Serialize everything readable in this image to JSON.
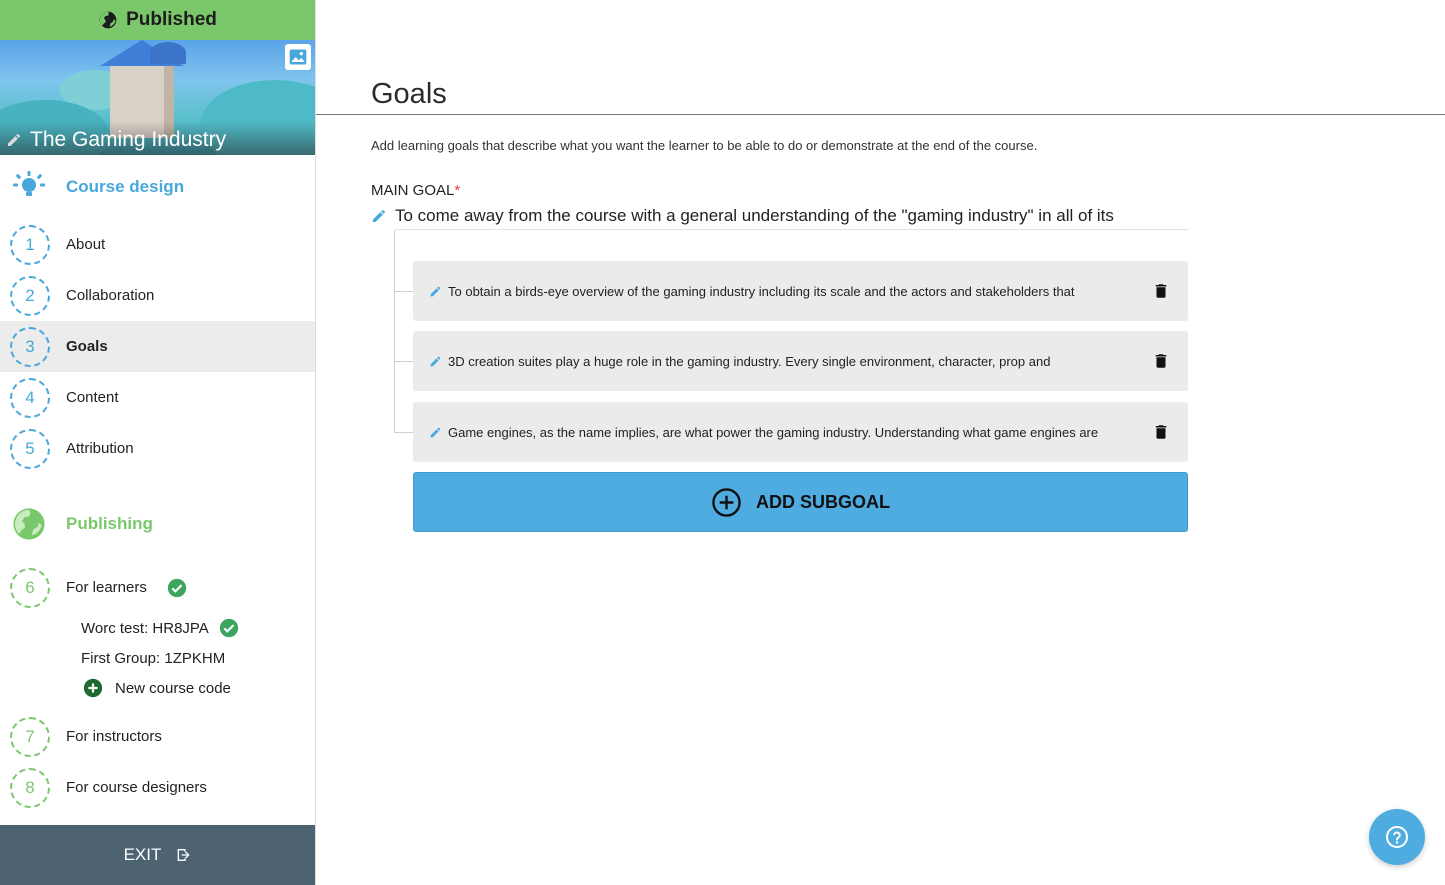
{
  "sidebar": {
    "status": "Published",
    "course_title": "The Gaming Industry",
    "design_heading": "Course design",
    "design_items": [
      {
        "num": "1",
        "label": "About"
      },
      {
        "num": "2",
        "label": "Collaboration"
      },
      {
        "num": "3",
        "label": "Goals"
      },
      {
        "num": "4",
        "label": "Content"
      },
      {
        "num": "5",
        "label": "Attribution"
      }
    ],
    "publishing_heading": "Publishing",
    "publishing_items": [
      {
        "num": "6",
        "label": "For learners"
      },
      {
        "num": "7",
        "label": "For instructors"
      },
      {
        "num": "8",
        "label": "For course designers"
      }
    ],
    "course_codes": [
      {
        "label": "Worc test: HR8JPA"
      },
      {
        "label": "First Group: 1ZPKHM"
      }
    ],
    "new_code_label": "New course code",
    "exit_label": "EXIT"
  },
  "main": {
    "title": "Goals",
    "description": "Add learning goals that describe what you want the learner to be able to do or demonstrate at the end of the course.",
    "main_goal_label": "MAIN GOAL",
    "required_mark": "*",
    "main_goal": "To come away from the course with a general understanding of the \"gaming industry\" in all of its",
    "subgoals": [
      "To obtain a birds-eye overview of the gaming industry including its scale and the actors and stakeholders that",
      "3D creation suites play a huge role in the gaming industry. Every single environment, character, prop and",
      "Game engines, as the name implies, are what power the gaming industry. Understanding what game engines are"
    ],
    "add_subgoal_label": "ADD SUBGOAL"
  },
  "colors": {
    "published_green": "#7bc86c",
    "accent_blue": "#48a8dc",
    "button_blue": "#4eace0",
    "exit_bar": "#4d6372",
    "required_red": "#e53935"
  }
}
